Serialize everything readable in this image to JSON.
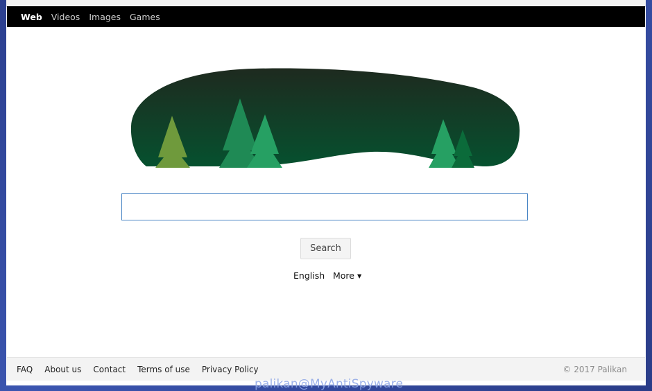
{
  "nav": {
    "items": [
      {
        "label": "Web"
      },
      {
        "label": "Videos"
      },
      {
        "label": "Images"
      },
      {
        "label": "Games"
      }
    ]
  },
  "search": {
    "value": "",
    "placeholder": "",
    "button_label": "Search"
  },
  "language": {
    "current": "English",
    "more_label": "More ▾"
  },
  "footer": {
    "links": [
      {
        "label": "FAQ"
      },
      {
        "label": "About us"
      },
      {
        "label": "Contact"
      },
      {
        "label": "Terms of use"
      },
      {
        "label": "Privacy Policy"
      }
    ],
    "copyright": "© 2017 Palikan"
  },
  "watermark": "palikan@MyAntiSpyware",
  "colors": {
    "nav_bg": "#000000",
    "logo_dark": "#1a2d22",
    "logo_green": "#0b5533",
    "tree_olive": "#6f9a3c",
    "tree_green": "#1f8a55",
    "search_border": "#4a86c5"
  }
}
